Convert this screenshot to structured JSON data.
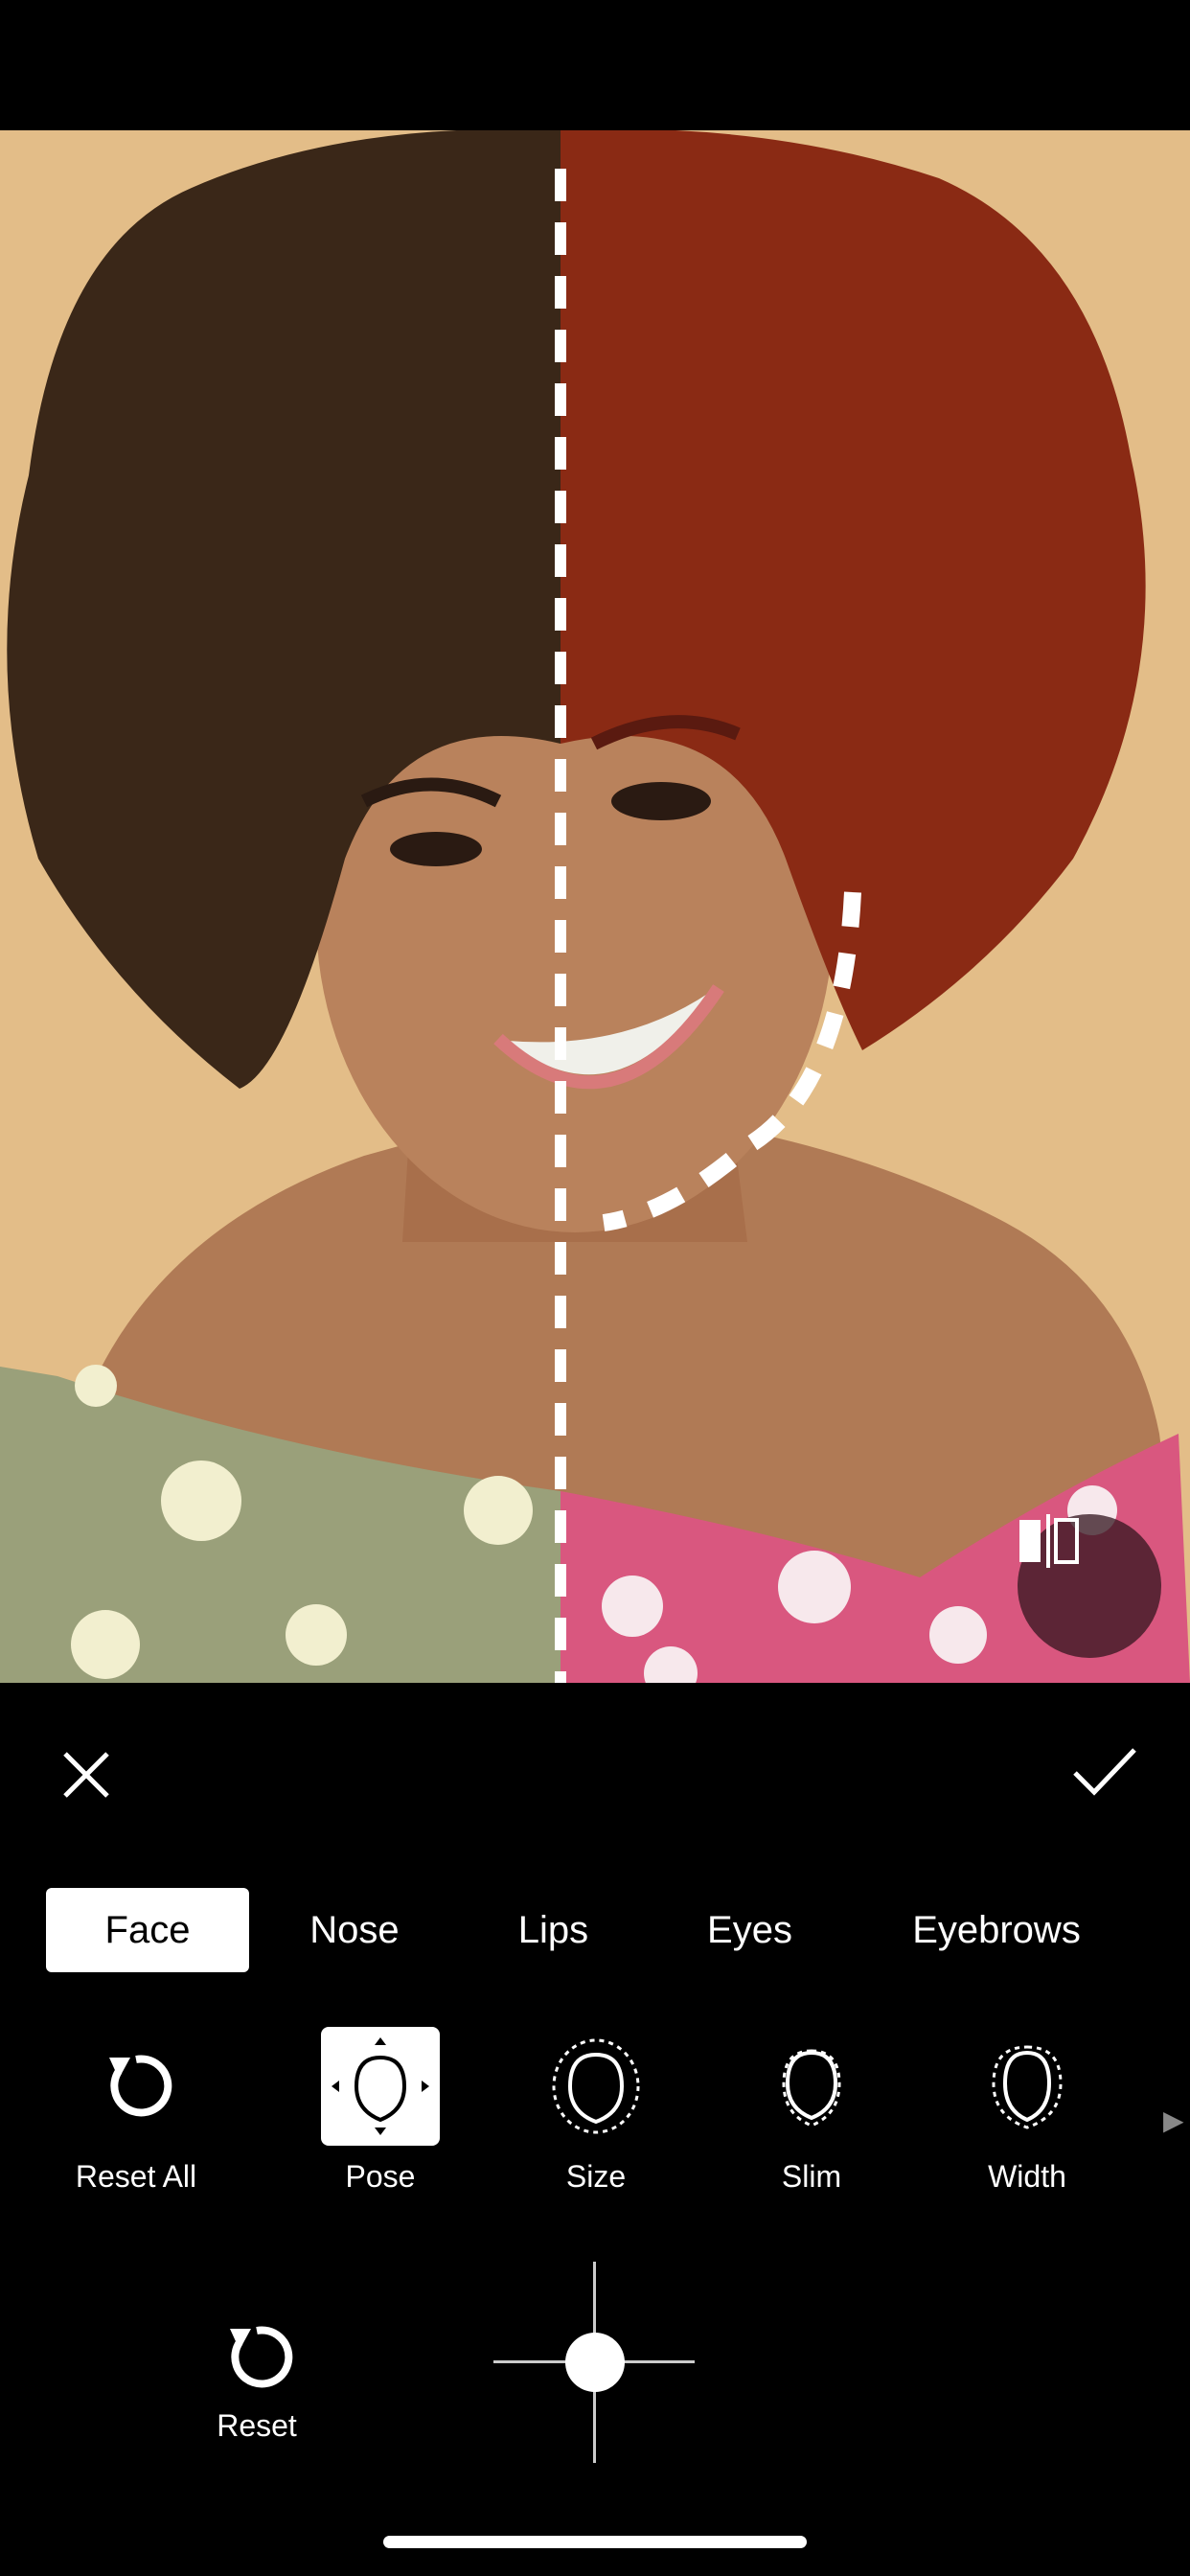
{
  "photo": {
    "background_color": "#e3bd88",
    "left_hair_color": "#3a2718",
    "right_hair_color": "#8a2a14",
    "left_top_color": "#9aa07a",
    "right_top_color": "#d9577f"
  },
  "compare_button": {
    "icon": "split-compare-icon"
  },
  "actions": {
    "close_icon": "close-icon",
    "confirm_icon": "checkmark-icon"
  },
  "tabs": [
    {
      "label": "Face",
      "active": true
    },
    {
      "label": "Nose",
      "active": false
    },
    {
      "label": "Lips",
      "active": false
    },
    {
      "label": "Eyes",
      "active": false
    },
    {
      "label": "Eyebrows",
      "active": false
    }
  ],
  "tools": [
    {
      "label": "Reset All",
      "icon": "reset-icon"
    },
    {
      "label": "Pose",
      "icon": "face-pose-icon",
      "active": true
    },
    {
      "label": "Size",
      "icon": "face-size-icon"
    },
    {
      "label": "Slim",
      "icon": "face-slim-icon"
    },
    {
      "label": "Width",
      "icon": "face-width-icon"
    }
  ],
  "reset": {
    "label": "Reset"
  },
  "accent_color": "#ffffff"
}
